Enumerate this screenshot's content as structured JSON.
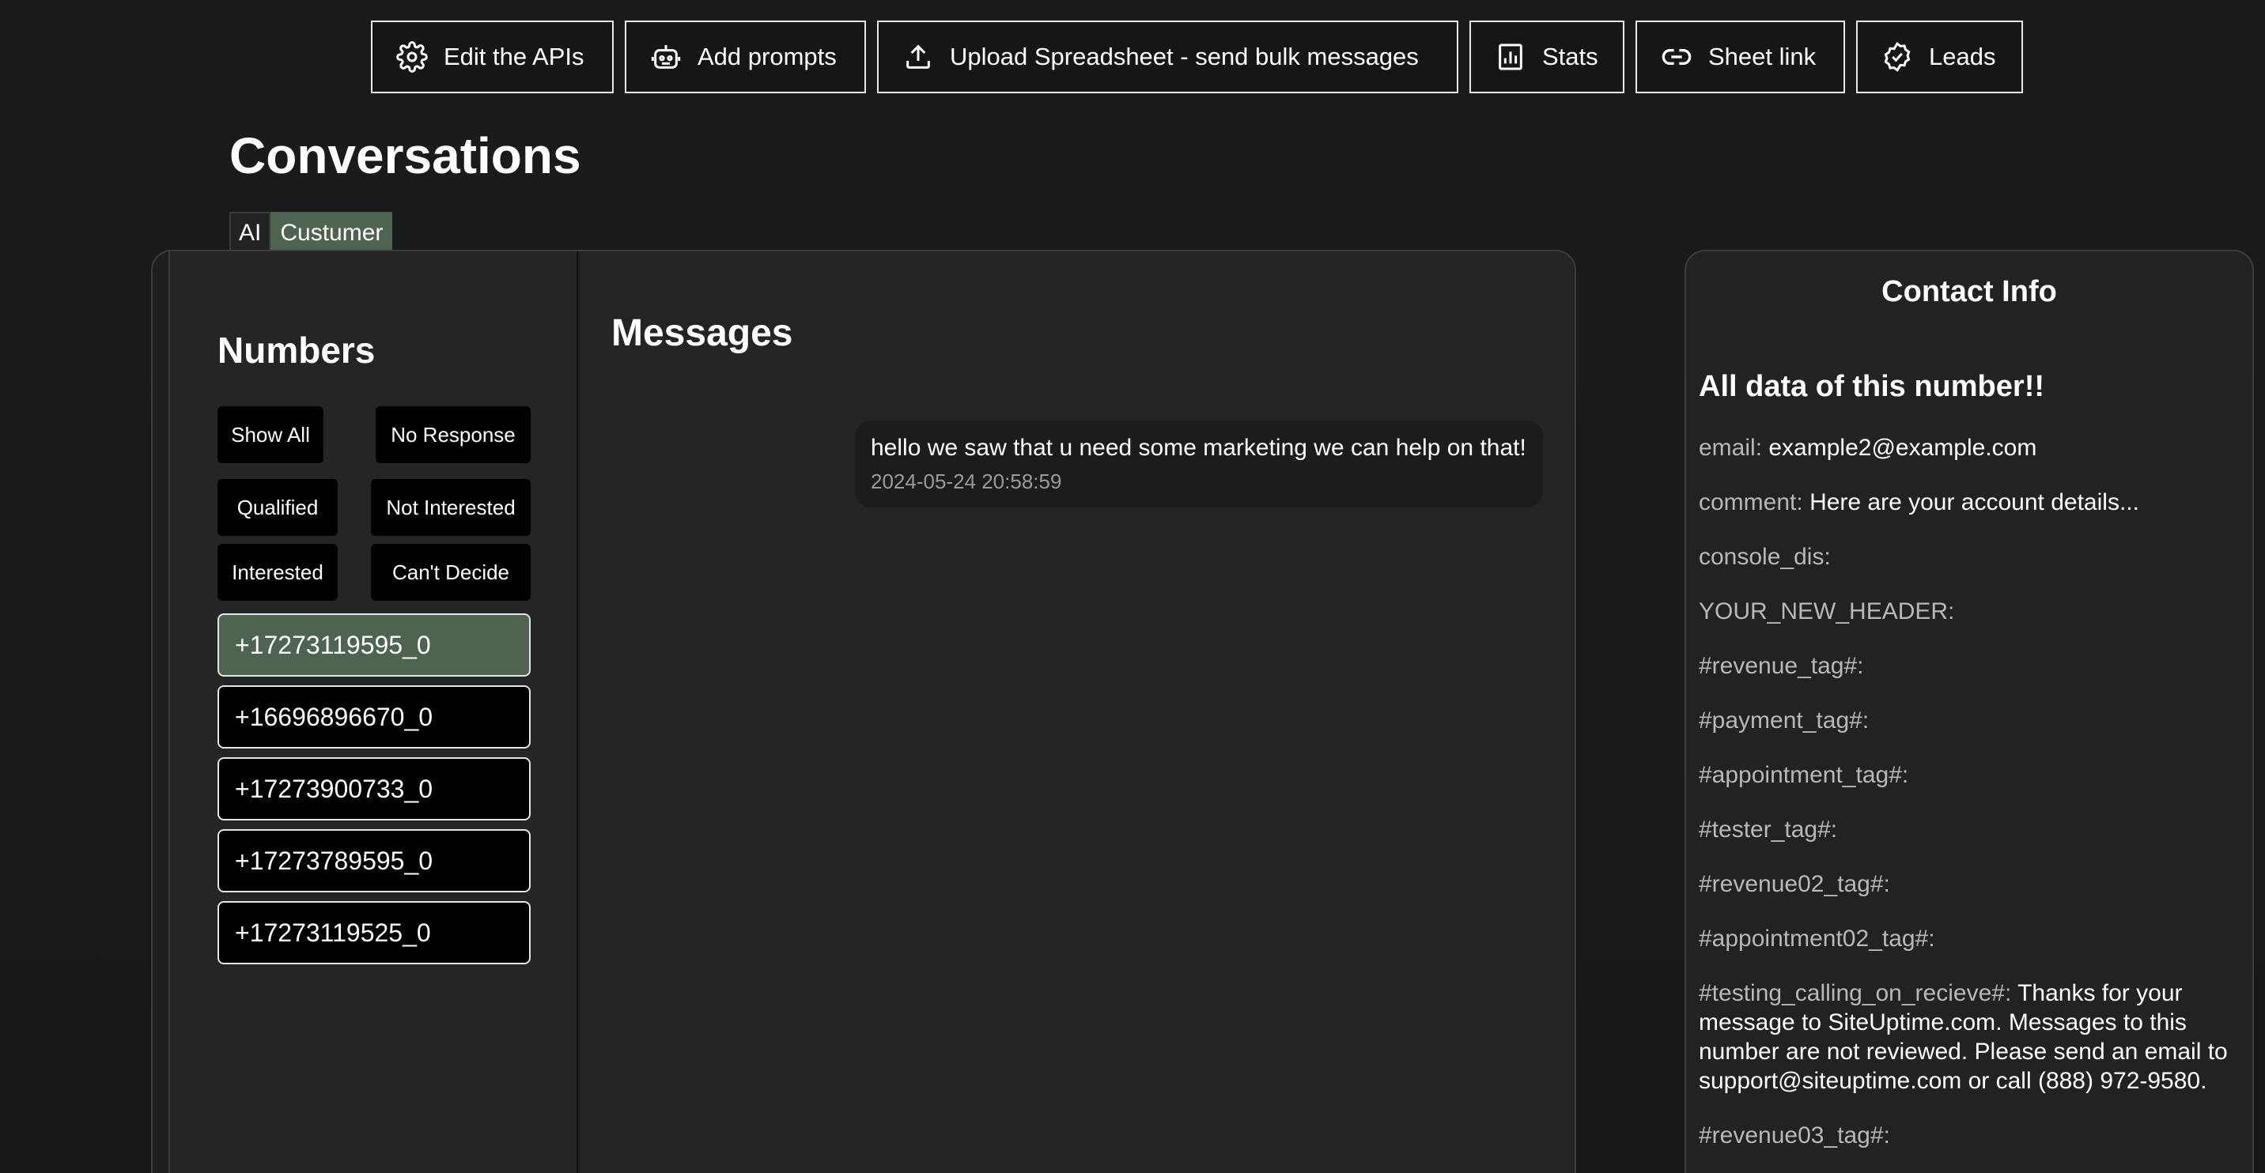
{
  "toolbar": {
    "edit_apis": "Edit the APIs",
    "add_prompts": "Add prompts",
    "upload": "Upload Spreadsheet - send bulk messages",
    "stats": "Stats",
    "sheet_link": "Sheet link",
    "leads": "Leads"
  },
  "page": {
    "title": "Conversations",
    "tabs": [
      {
        "label": "AI",
        "active": false
      },
      {
        "label": "Custumer",
        "active": true
      }
    ]
  },
  "numbers": {
    "title": "Numbers",
    "filters": {
      "show_all": "Show All",
      "no_response": "No Response",
      "qualified": "Qualified",
      "not_interested": "Not Interested",
      "interested": "Interested",
      "cant_decide": "Can't Decide"
    },
    "items": [
      {
        "label": "+17273119595_0",
        "selected": true
      },
      {
        "label": "+16696896670_0",
        "selected": false
      },
      {
        "label": "+17273900733_0",
        "selected": false
      },
      {
        "label": "+17273789595_0",
        "selected": false
      },
      {
        "label": "+17273119525_0",
        "selected": false
      }
    ]
  },
  "messages": {
    "title": "Messages",
    "items": [
      {
        "text": "hello we saw that u need some marketing we can help on that!",
        "time": "2024-05-24 20:58:59"
      }
    ]
  },
  "contact": {
    "title": "Contact Info",
    "subtitle": "All data of this number!!",
    "fields": [
      {
        "key": "email:",
        "value": "example2@example.com"
      },
      {
        "key": "comment:",
        "value": "Here are your account details..."
      },
      {
        "key": "console_dis:",
        "value": ""
      },
      {
        "key": "YOUR_NEW_HEADER:",
        "value": ""
      },
      {
        "key": "#revenue_tag#:",
        "value": ""
      },
      {
        "key": "#payment_tag#:",
        "value": ""
      },
      {
        "key": "#appointment_tag#:",
        "value": ""
      },
      {
        "key": "#tester_tag#:",
        "value": ""
      },
      {
        "key": "#revenue02_tag#:",
        "value": ""
      },
      {
        "key": "#appointment02_tag#:",
        "value": ""
      },
      {
        "key": "#testing_calling_on_recieve#:",
        "value": "Thanks for your message to SiteUptime.com. Messages to this number are not reviewed. Please send an email to support@siteuptime.com or call (888) 972-9580."
      },
      {
        "key": "#revenue03_tag#:",
        "value": ""
      }
    ]
  },
  "colors": {
    "accent_selected": "#4f6450",
    "background": "#181a1a",
    "panel": "#232424"
  }
}
